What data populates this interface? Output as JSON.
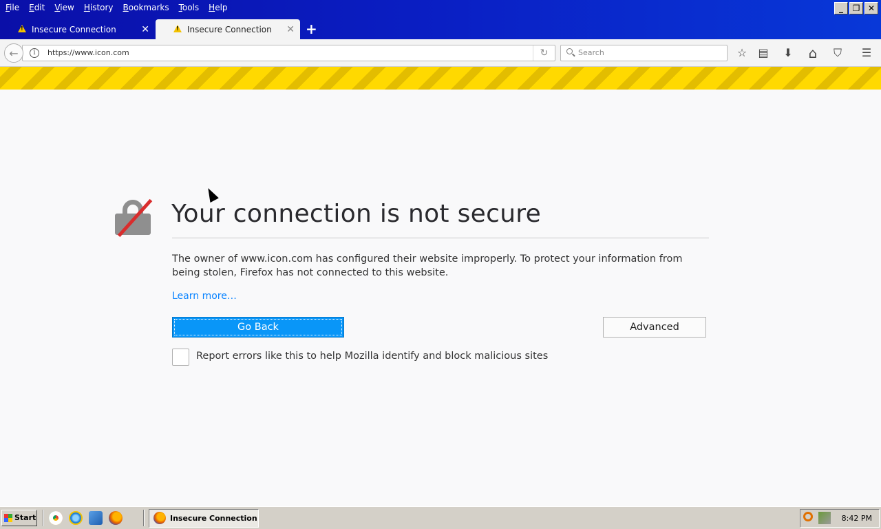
{
  "menu": {
    "items": [
      {
        "label": "File",
        "accel": "F",
        "rest": "ile"
      },
      {
        "label": "Edit",
        "accel": "E",
        "rest": "dit"
      },
      {
        "label": "View",
        "accel": "V",
        "rest": "iew"
      },
      {
        "label": "History",
        "accel": "H",
        "rest": "istory"
      },
      {
        "label": "Bookmarks",
        "accel": "B",
        "rest": "ookmarks"
      },
      {
        "label": "Tools",
        "accel": "T",
        "rest": "ools"
      },
      {
        "label": "Help",
        "accel": "H",
        "rest": "elp"
      }
    ]
  },
  "window_controls": {
    "minimize": "_",
    "restore": "❐",
    "close": "✕"
  },
  "tabs": [
    {
      "label": "Insecure Connection",
      "close": "✕",
      "active": false
    },
    {
      "label": "Insecure Connection",
      "close": "✕",
      "active": true
    }
  ],
  "new_tab": "+",
  "navbar": {
    "back": "←",
    "url": "https://www.icon.com",
    "reload": "↻",
    "search_placeholder": "Search",
    "icons": [
      "star-icon",
      "reading-list-icon",
      "download-icon",
      "home-icon",
      "pocket-icon",
      "hamburger-menu-icon"
    ],
    "icon_glyphs": {
      "star": "☆",
      "reading": "▤",
      "download": "⬇",
      "home": "⌂",
      "pocket": "⛉",
      "menu": "☰"
    }
  },
  "error_page": {
    "title": "Your connection is not secure",
    "description": "The owner of www.icon.com has configured their website improperly. To protect your information from being stolen, Firefox has not connected to this website.",
    "learn_more": "Learn more…",
    "go_back": "Go Back",
    "advanced": "Advanced",
    "report_checkbox_label": "Report errors like this to help Mozilla identify and block malicious sites"
  },
  "taskbar": {
    "start": "Start",
    "task_item": "Insecure Connection",
    "clock": "8:42 PM",
    "quick_launch": [
      "chrome-icon",
      "ie-icon",
      "outlook-icon",
      "firefox-icon"
    ]
  },
  "colors": {
    "titlebar": "#0a1fc4",
    "warning_stripe": "#ffd900",
    "primary_button": "#0996f8",
    "link": "#0a84ff",
    "lock_slash": "#d92d2d"
  }
}
